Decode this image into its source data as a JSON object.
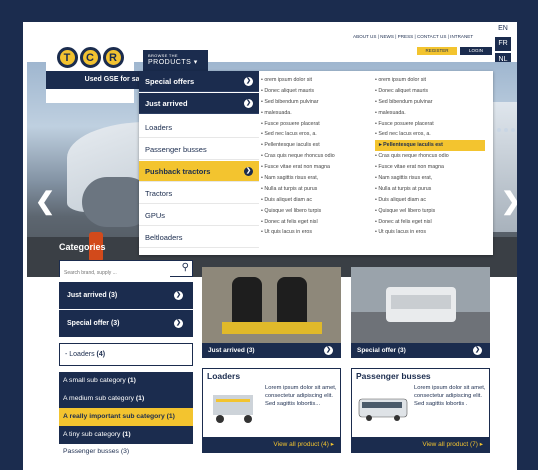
{
  "top_nav": "ABOUT US | NEWS | PRESS | CONTACT US | INTRANET",
  "languages": [
    "EN",
    "FR",
    "NL"
  ],
  "logo": {
    "letters": [
      "T",
      "C",
      "R"
    ],
    "tagline": "Used GSE for sale"
  },
  "browse": {
    "line1": "BROWSE THE",
    "line2": "PRODUCTS ▾"
  },
  "register_label": "REGISTER",
  "login_label": "LOGIN",
  "menu": {
    "items": [
      {
        "label": "Special offers",
        "style": "dark",
        "chevron": true
      },
      {
        "label": "Just arrived",
        "style": "dark",
        "chevron": true
      },
      {
        "label": "Loaders",
        "style": "plain",
        "chevron": false
      },
      {
        "label": "Passenger busses",
        "style": "plain",
        "chevron": false
      },
      {
        "label": "Pushback tractors",
        "style": "yellow",
        "chevron": true
      },
      {
        "label": "Tractors",
        "style": "plain",
        "chevron": false
      },
      {
        "label": "GPUs",
        "style": "plain",
        "chevron": false
      },
      {
        "label": "Beltloaders",
        "style": "plain",
        "chevron": false
      }
    ],
    "col1": [
      "• orem ipsum dolor sit",
      "• Donec aliquet mauris",
      "• Sed bibendum pulvinar",
      "• malesuada.",
      "• Fusce posuere placerat",
      "• Sed nec lacus eros, a.",
      "• Pellentesque iaculis est",
      "• Cras quis neque rhoncus odio",
      "• Fusce vitae erat non magna",
      "• Nam sagittis risus erat,",
      "• Nulla at turpis at purus",
      "• Duis aliquet diam ac",
      "• Quisque vel libero turpis",
      "• Donec at felis eget nisl",
      "• Ut quis lacus in eros"
    ],
    "col2": [
      "• orem ipsum dolor sit",
      "• Donec aliquet mauris",
      "• Sed bibendum pulvinar",
      "• malesuada.",
      "• Fusce posuere placerat",
      "• Sed nec lacus eros, a.",
      "▸ Pellentesque iaculis est",
      "• Cras quis neque rhoncus odio",
      "• Fusce vitae erat non magna",
      "• Nam sagittis risus erat,",
      "• Nulla at turpis at purus",
      "• Duis aliquet diam ac",
      "• Quisque vel libero turpis",
      "• Donec at felis eget nisl",
      "• Ut quis lacus in eros"
    ]
  },
  "categories": {
    "title": "Categories",
    "search_placeholder": "Search brand, supply ...",
    "buttons": [
      "Just arrived (3)",
      "Special offer (3)"
    ],
    "loaders_label": "- Loaders",
    "loaders_count": "(4)",
    "subs": [
      {
        "label": "A small sub category",
        "count": "(1)"
      },
      {
        "label": "A medium sub category",
        "count": "(1)"
      },
      {
        "label": "A really important sub category",
        "count": "(1)"
      },
      {
        "label": "A tiny sub category",
        "count": "(1)"
      },
      {
        "label": "Passenger busses",
        "count": "(3)"
      }
    ]
  },
  "tiles": [
    "Just arrived (3)",
    "Special offer (3)"
  ],
  "boxes": [
    {
      "title": "Loaders",
      "text": "Lorem ipsum dolor sit amet, consectetur adipiscing elit. Sed sagittis lobortis...",
      "footer": "View all product (4) ▸"
    },
    {
      "title": "Passenger busses",
      "text": "Lorem ipsum dolor sit amet, consectetur adipiscing elit. Sed sagittis lobortis .",
      "footer": "View all product (7) ▸"
    }
  ],
  "colors": {
    "navy": "#1b2c4e",
    "yellow": "#f3c42f"
  }
}
